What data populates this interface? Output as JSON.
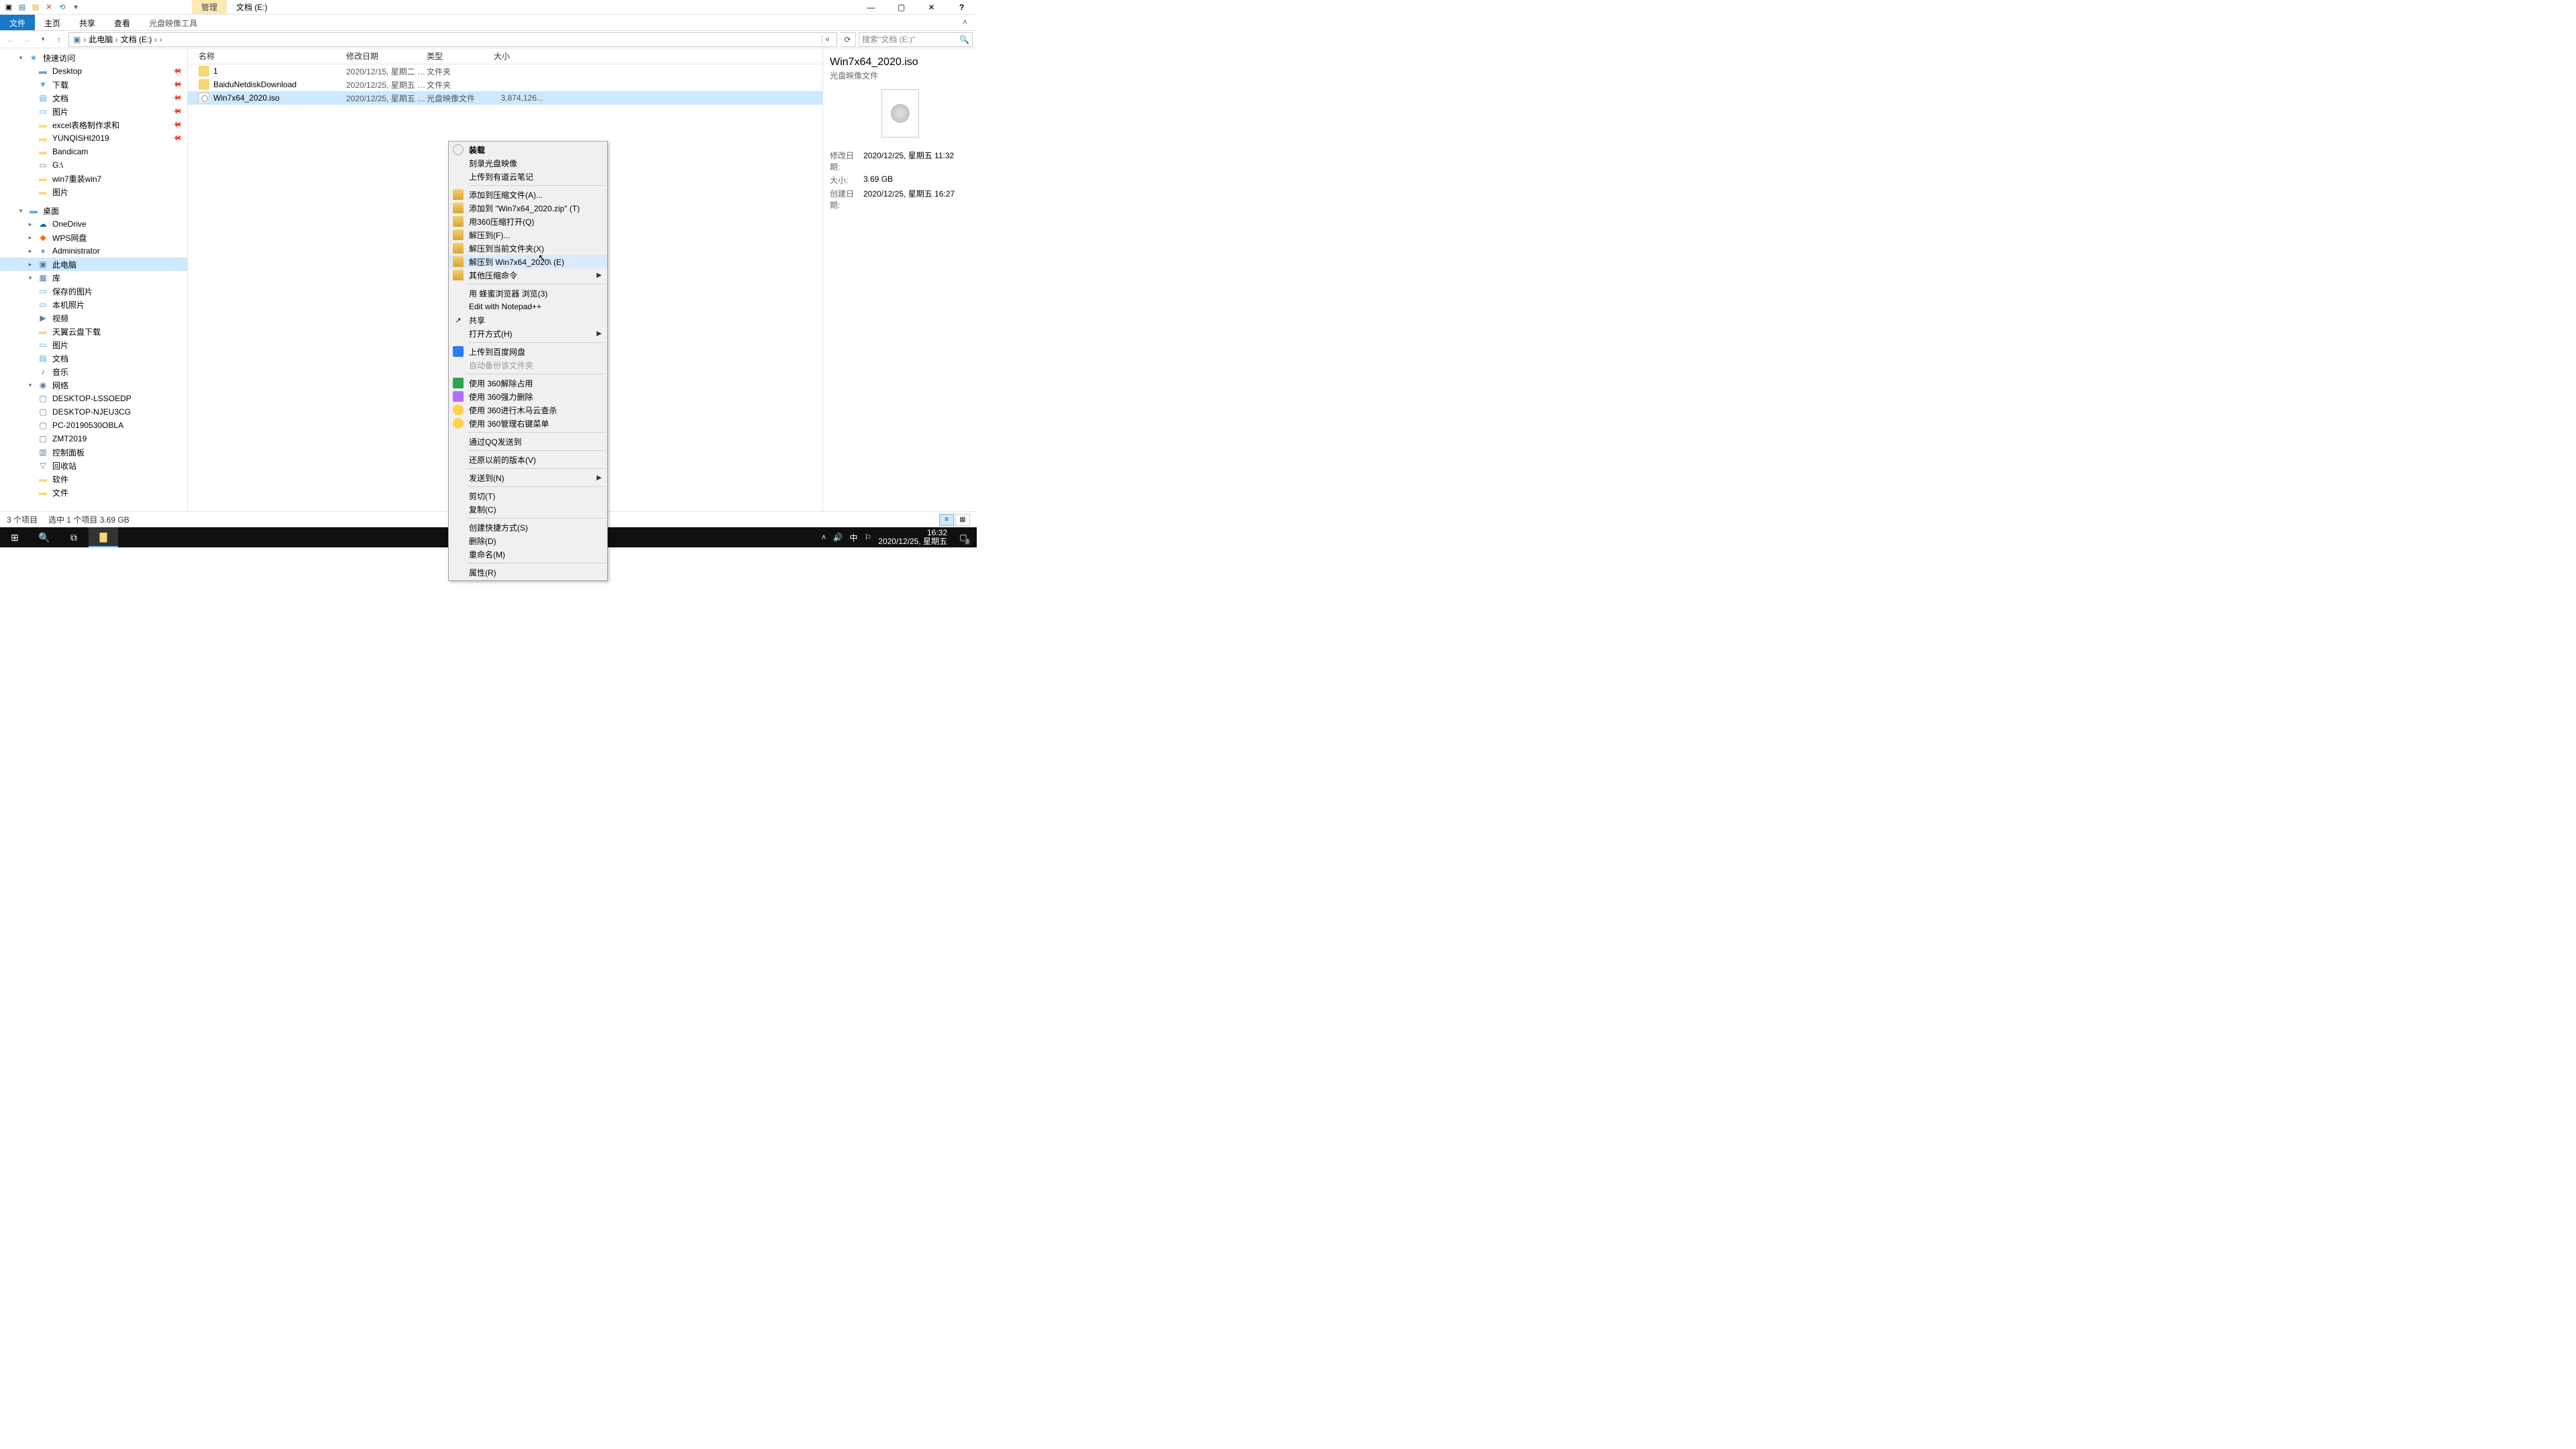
{
  "titleBar": {
    "contextTab": "管理",
    "windowName": "文档 (E:)"
  },
  "ribbon": {
    "file": "文件",
    "tabs": [
      "主页",
      "共享",
      "查看"
    ],
    "contextTab": "光盘映像工具"
  },
  "address": {
    "crumbs": [
      "此电脑",
      "文档 (E:)"
    ],
    "searchPlaceholder": "搜索\"文档 (E:)\""
  },
  "tree": [
    {
      "icon": "star",
      "label": "快速访问",
      "depth": 1,
      "head": true,
      "exp": "▾"
    },
    {
      "icon": "desk",
      "label": "Desktop",
      "depth": 2,
      "pin": true
    },
    {
      "icon": "down",
      "label": "下载",
      "depth": 2,
      "pin": true
    },
    {
      "icon": "doc",
      "label": "文档",
      "depth": 2,
      "pin": true
    },
    {
      "icon": "pic",
      "label": "图片",
      "depth": 2,
      "pin": true
    },
    {
      "icon": "fold",
      "label": "excel表格制作求和",
      "depth": 2,
      "pin": true
    },
    {
      "icon": "fold",
      "label": "YUNQISHI2019",
      "depth": 2,
      "pin": true
    },
    {
      "icon": "fold",
      "label": "Bandicam",
      "depth": 2
    },
    {
      "icon": "drive",
      "label": "G:\\",
      "depth": 2
    },
    {
      "icon": "fold",
      "label": "win7重装win7",
      "depth": 2
    },
    {
      "icon": "fold",
      "label": "图片",
      "depth": 2
    },
    {
      "spacer": true
    },
    {
      "icon": "desk",
      "label": "桌面",
      "depth": 1,
      "head": true,
      "exp": "▾"
    },
    {
      "icon": "cloud",
      "label": "OneDrive",
      "depth": 2,
      "exp": "▸"
    },
    {
      "icon": "wps",
      "label": "WPS网盘",
      "depth": 2,
      "exp": "▸"
    },
    {
      "icon": "user",
      "label": "Administrator",
      "depth": 2,
      "exp": "▸"
    },
    {
      "icon": "pc",
      "label": "此电脑",
      "depth": 2,
      "exp": "▸",
      "selected": true
    },
    {
      "icon": "lib",
      "label": "库",
      "depth": 2,
      "exp": "▾"
    },
    {
      "icon": "pic",
      "label": "保存的图片",
      "depth": 2,
      "sub": true
    },
    {
      "icon": "pic",
      "label": "本机照片",
      "depth": 2,
      "sub": true
    },
    {
      "icon": "vid",
      "label": "视频",
      "depth": 2,
      "sub": true
    },
    {
      "icon": "fold",
      "label": "天翼云盘下载",
      "depth": 2,
      "sub": true
    },
    {
      "icon": "pic",
      "label": "图片",
      "depth": 2,
      "sub": true
    },
    {
      "icon": "doc",
      "label": "文档",
      "depth": 2,
      "sub": true
    },
    {
      "icon": "mus",
      "label": "音乐",
      "depth": 2,
      "sub": true
    },
    {
      "icon": "net",
      "label": "网络",
      "depth": 2,
      "exp": "▾"
    },
    {
      "icon": "mon",
      "label": "DESKTOP-LSSOEDP",
      "depth": 2,
      "sub": true
    },
    {
      "icon": "mon",
      "label": "DESKTOP-NJEU3CG",
      "depth": 2,
      "sub": true
    },
    {
      "icon": "mon",
      "label": "PC-20190530OBLA",
      "depth": 2,
      "sub": true
    },
    {
      "icon": "mon",
      "label": "ZMT2019",
      "depth": 2,
      "sub": true
    },
    {
      "icon": "ctrl",
      "label": "控制面板",
      "depth": 2
    },
    {
      "icon": "bin",
      "label": "回收站",
      "depth": 2
    },
    {
      "icon": "fold",
      "label": "软件",
      "depth": 2
    },
    {
      "icon": "fold",
      "label": "文件",
      "depth": 2
    }
  ],
  "columns": [
    "名称",
    "修改日期",
    "类型",
    "大小"
  ],
  "files": [
    {
      "icon": "fold",
      "name": "1",
      "date": "2020/12/15, 星期二 1...",
      "type": "文件夹",
      "size": ""
    },
    {
      "icon": "fold",
      "name": "BaiduNetdiskDownload",
      "date": "2020/12/25, 星期五 1...",
      "type": "文件夹",
      "size": ""
    },
    {
      "icon": "iso",
      "name": "Win7x64_2020.iso",
      "date": "2020/12/25, 星期五 1...",
      "type": "光盘映像文件",
      "size": "3,874,126...",
      "selected": true
    }
  ],
  "contextMenu": [
    {
      "label": "装载",
      "icon": "disc",
      "bold": true
    },
    {
      "label": "刻录光盘映像"
    },
    {
      "label": "上传到有道云笔记",
      "icon": "up"
    },
    {
      "sep": true
    },
    {
      "label": "添加到压缩文件(A)...",
      "icon": "zip"
    },
    {
      "label": "添加到 \"Win7x64_2020.zip\" (T)",
      "icon": "zip"
    },
    {
      "label": "用360压缩打开(Q)",
      "icon": "zip"
    },
    {
      "label": "解压到(F)...",
      "icon": "zip"
    },
    {
      "label": "解压到当前文件夹(X)",
      "icon": "zip"
    },
    {
      "label": "解压到 Win7x64_2020\\ (E)",
      "icon": "zip",
      "hilite": true
    },
    {
      "label": "其他压缩命令",
      "icon": "zip",
      "sub": true
    },
    {
      "sep": true
    },
    {
      "label": "用 蜂蜜浏览器 浏览(3)",
      "icon": "bee"
    },
    {
      "label": "Edit with Notepad++",
      "icon": "npp"
    },
    {
      "label": "共享",
      "icon": "share"
    },
    {
      "label": "打开方式(H)",
      "sub": true
    },
    {
      "sep": true
    },
    {
      "label": "上传到百度网盘",
      "icon": "bd"
    },
    {
      "label": "自动备份该文件夹",
      "disabled": true
    },
    {
      "sep": true
    },
    {
      "label": "使用 360解除占用",
      "icon": "g360"
    },
    {
      "label": "使用 360强力删除",
      "icon": "del360"
    },
    {
      "label": "使用 360进行木马云查杀",
      "icon": "shc"
    },
    {
      "label": "使用 360管理右键菜单",
      "icon": "shc"
    },
    {
      "sep": true
    },
    {
      "label": "通过QQ发送到"
    },
    {
      "sep": true
    },
    {
      "label": "还原以前的版本(V)"
    },
    {
      "sep": true
    },
    {
      "label": "发送到(N)",
      "sub": true
    },
    {
      "sep": true
    },
    {
      "label": "剪切(T)"
    },
    {
      "label": "复制(C)"
    },
    {
      "sep": true
    },
    {
      "label": "创建快捷方式(S)"
    },
    {
      "label": "删除(D)"
    },
    {
      "label": "重命名(M)"
    },
    {
      "sep": true
    },
    {
      "label": "属性(R)"
    }
  ],
  "details": {
    "name": "Win7x64_2020.iso",
    "type": "光盘映像文件",
    "meta": [
      [
        "修改日期:",
        "2020/12/25, 星期五 11:32"
      ],
      [
        "大小:",
        "3.69 GB"
      ],
      [
        "创建日期:",
        "2020/12/25, 星期五 16:27"
      ]
    ]
  },
  "status": {
    "count": "3 个项目",
    "selection": "选中 1 个项目  3.69 GB"
  },
  "taskbar": {
    "ime": "中",
    "time": "16:32",
    "date": "2020/12/25, 星期五"
  }
}
